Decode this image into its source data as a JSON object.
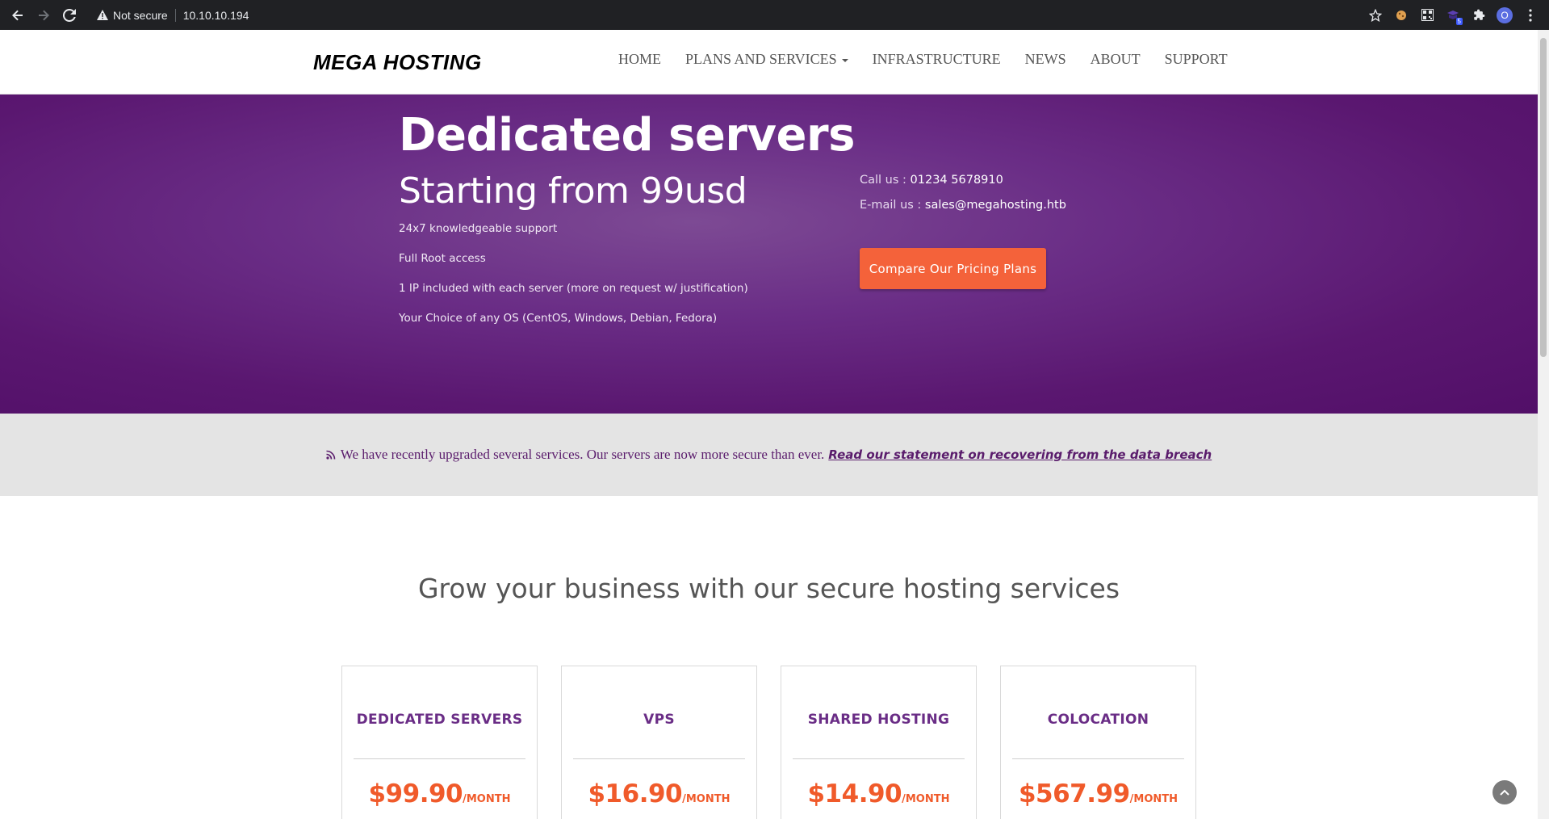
{
  "browser": {
    "security_label": "Not secure",
    "url": "10.10.10.194",
    "extension_badge": "5",
    "profile_initial": "O"
  },
  "header": {
    "logo": "MEGA HOSTING",
    "menu": [
      "HOME",
      "PLANS AND SERVICES",
      "INFRASTRUCTURE",
      "NEWS",
      "ABOUT",
      "SUPPORT"
    ]
  },
  "hero": {
    "title": "Dedicated servers",
    "subtitle": "Starting from 99usd",
    "features": [
      "24x7 knowledgeable support",
      "Full Root access",
      "1 IP included with each server (more on request w/ justification)",
      "Your Choice of any OS (CentOS, Windows, Debian, Fedora)"
    ],
    "call_label": "Call us : ",
    "call_value": "01234 5678910",
    "email_label": "E-mail us : ",
    "email_value": "sales@megahosting.htb",
    "cta": "Compare Our Pricing Plans"
  },
  "notice": {
    "text": "We have recently upgraded several services. Our servers are now more secure than ever.",
    "link": "Read our statement on recovering from the data breach"
  },
  "main": {
    "heading": "Grow your business with our secure hosting services",
    "plans": [
      {
        "name": "DEDICATED SERVERS",
        "price": "$99.90",
        "period": "/MONTH"
      },
      {
        "name": "VPS",
        "price": "$16.90",
        "period": "/MONTH"
      },
      {
        "name": "SHARED HOSTING",
        "price": "$14.90",
        "period": "/MONTH"
      },
      {
        "name": "COLOCATION",
        "price": "$567.99",
        "period": "/MONTH"
      }
    ]
  },
  "colors": {
    "brand_purple": "#6a2d86",
    "accent_orange": "#f4623a"
  }
}
